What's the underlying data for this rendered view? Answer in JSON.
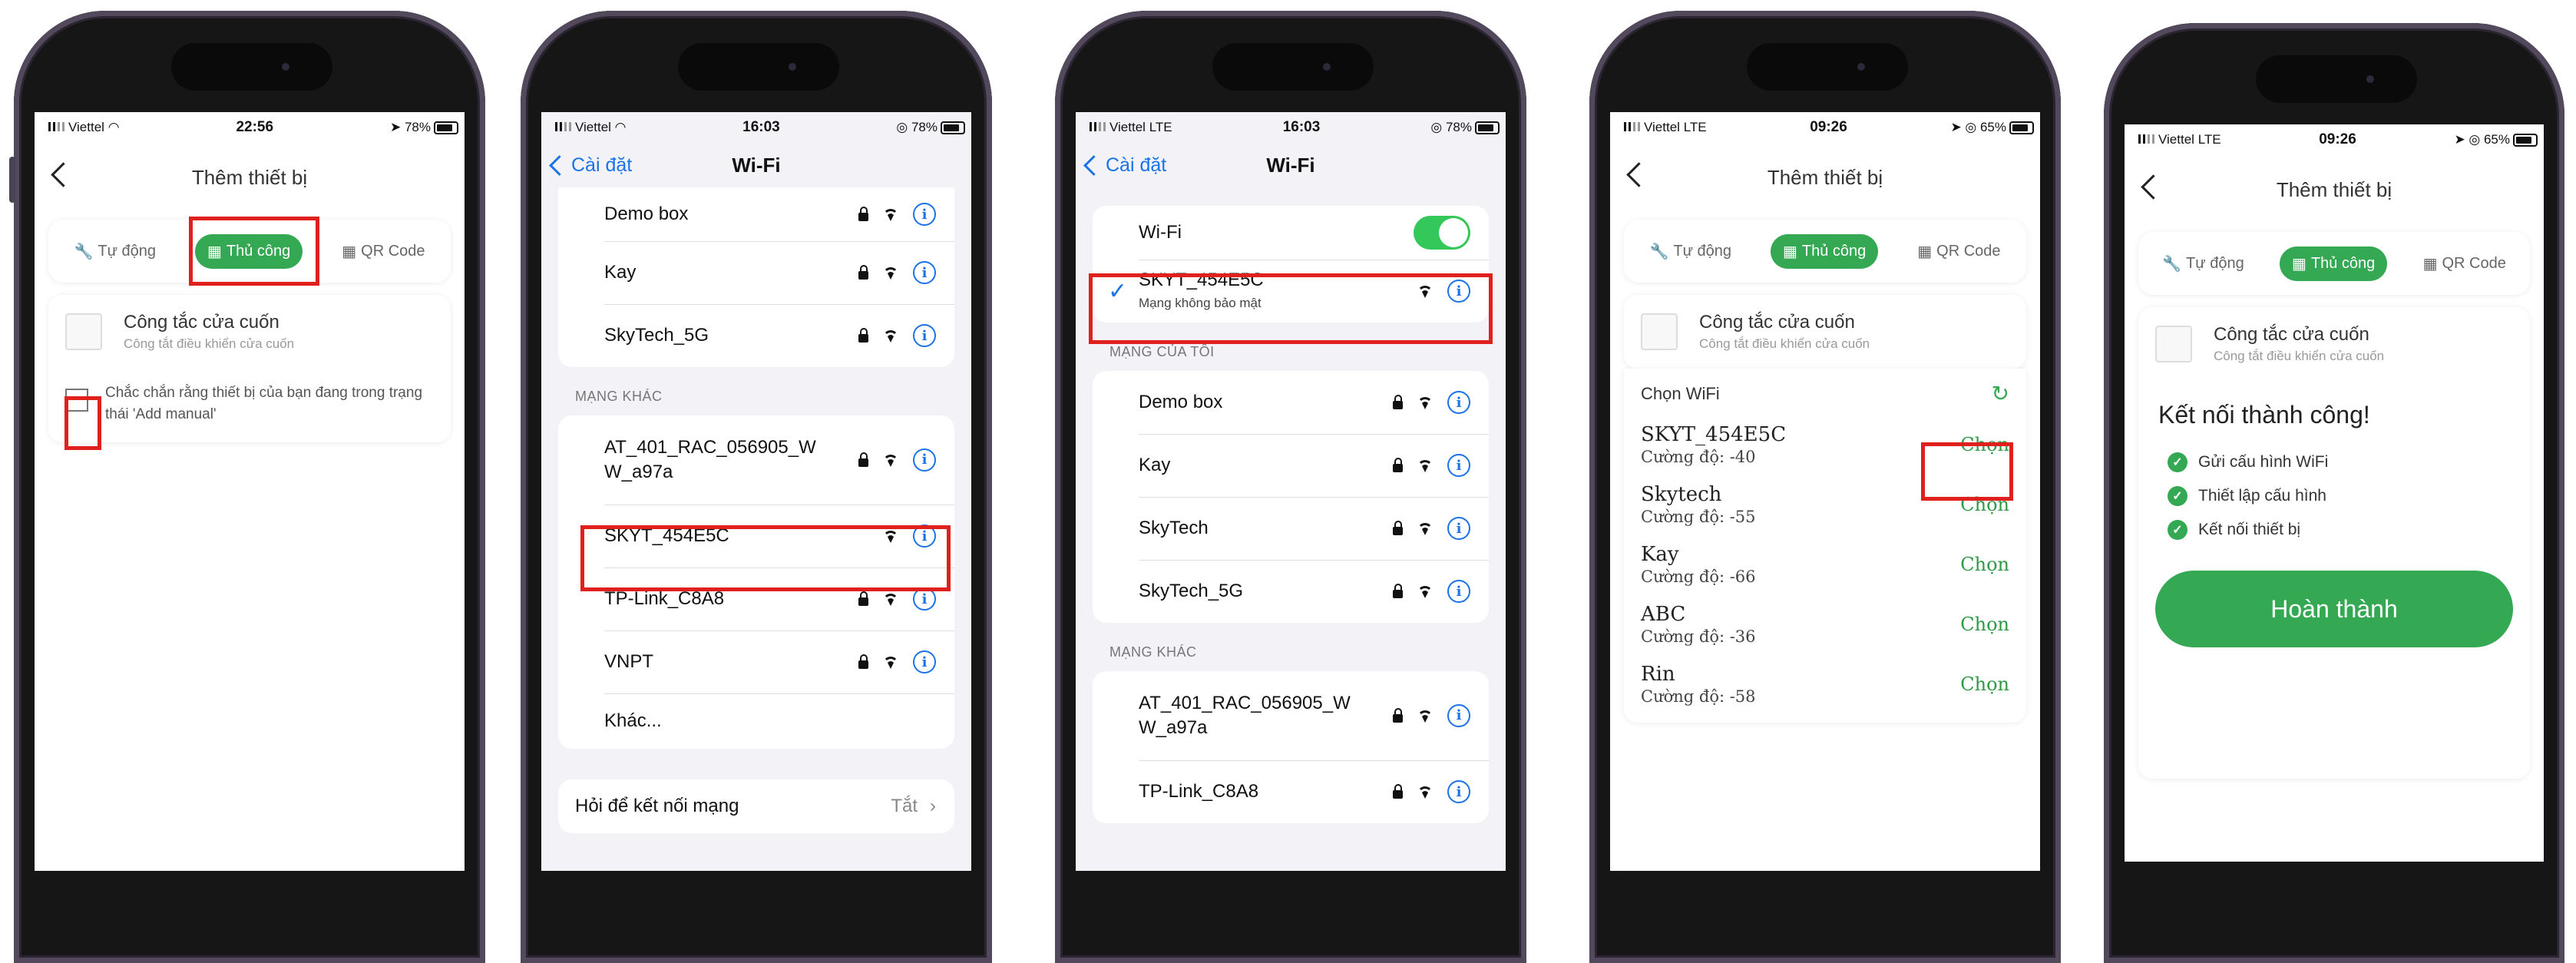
{
  "p1": {
    "status": {
      "carrier": "Viettel",
      "time": "22:56",
      "battery": "78%"
    },
    "title": "Thêm thiết bị",
    "tabs": [
      "Tự động",
      "Thủ công",
      "QR Code"
    ],
    "device": {
      "name": "Công tắc cửa cuốn",
      "sub": "Công tắt điều khiển cửa cuốn"
    },
    "confirm": "Chắc chắn rằng thiết bị của bạn đang trong trạng thái 'Add manual'"
  },
  "p2": {
    "status": {
      "carrier": "Viettel",
      "time": "16:03",
      "battery": "78%"
    },
    "back": "Cài đặt",
    "title": "Wi-Fi",
    "mine": [
      "Demo box",
      "Kay",
      "SkyTech_5G"
    ],
    "other_header": "MẠNG KHÁC",
    "other": [
      "AT_401_RAC_056905_W W_a97a",
      "SKYT_454E5C",
      "TP-Link_C8A8",
      "VNPT",
      "Khác..."
    ],
    "ask_label": "Hỏi để kết nối mạng",
    "ask_value": "Tắt"
  },
  "p3": {
    "status": {
      "carrier": "Viettel",
      "network": "LTE",
      "time": "16:03",
      "battery": "78%"
    },
    "back": "Cài đặt",
    "title": "Wi-Fi",
    "wifi_label": "Wi-Fi",
    "connected": {
      "name": "SKYT_454E5C",
      "sub": "Mạng không bảo mật"
    },
    "mine_header": "MẠNG CỦA TÔI",
    "mine": [
      "Demo box",
      "Kay",
      "SkyTech",
      "SkyTech_5G"
    ],
    "other_header": "MẠNG KHÁC",
    "other": [
      "AT_401_RAC_056905_W W_a97a",
      "TP-Link_C8A8"
    ]
  },
  "p4": {
    "status": {
      "carrier": "Viettel",
      "network": "LTE",
      "time": "09:26",
      "battery": "65%"
    },
    "title": "Thêm thiết bị",
    "tabs": [
      "Tự động",
      "Thủ công",
      "QR Code"
    ],
    "device": {
      "name": "Công tắc cửa cuốn",
      "sub": "Công tắt điều khiển cửa cuốn"
    },
    "choose_wifi": "Chọn WiFi",
    "choose_btn": "Chọn",
    "networks": [
      {
        "name": "SKYT_454E5C",
        "strength": "Cường độ: -40"
      },
      {
        "name": "Skytech",
        "strength": "Cường độ: -55"
      },
      {
        "name": "Kay",
        "strength": "Cường độ: -66"
      },
      {
        "name": "ABC",
        "strength": "Cường độ: -36"
      },
      {
        "name": "Rin",
        "strength": "Cường độ: -58"
      }
    ]
  },
  "p5": {
    "status": {
      "carrier": "Viettel",
      "network": "LTE",
      "time": "09:26",
      "battery": "65%"
    },
    "title": "Thêm thiết bị",
    "tabs": [
      "Tự động",
      "Thủ công",
      "QR Code"
    ],
    "device": {
      "name": "Công tắc cửa cuốn",
      "sub": "Công tắt điều khiển cửa cuốn"
    },
    "success": "Kết nối thành công!",
    "steps": [
      "Gửi cấu hình WiFi",
      "Thiết lập cấu hình",
      "Kết nối thiết bị"
    ],
    "done": "Hoàn thành"
  },
  "colors": {
    "green": "#34a853",
    "ios_blue": "#1a73e8",
    "highlight_red": "#e0201c"
  }
}
